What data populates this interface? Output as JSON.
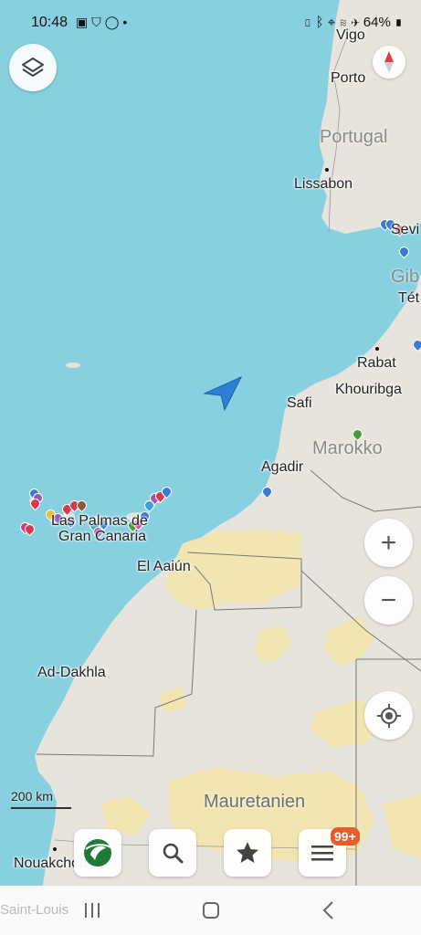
{
  "status_bar": {
    "time": "10:48",
    "left_icons": [
      "image-icon",
      "shield-icon",
      "whatsapp-icon",
      "dot-icon"
    ],
    "right_icons": [
      "sim-icon",
      "bluetooth-icon",
      "location-icon",
      "wifi-icon",
      "airplane-icon",
      "battery-icon"
    ],
    "battery": "64%"
  },
  "map": {
    "labels": {
      "vigo": "Vigo",
      "porto": "Porto",
      "portugal": "Portugal",
      "lissabon": "Lissabon",
      "sevilla": "Sevi",
      "gibraltar": "Gib",
      "tetouan": "Tét",
      "rabat": "Rabat",
      "khouribga": "Khouribga",
      "safi": "Safi",
      "marokko": "Marokko",
      "agadir": "Agadir",
      "las_palmas": "Las Palmas de",
      "gran_canaria": "Gran Canaria",
      "el_aaiun": "El Aaiún",
      "ad_dakhla": "Ad-Dakhla",
      "mauretanien": "Mauretanien",
      "nouakchott": "Nouakchott",
      "saint_louis": "Saint-Louis"
    },
    "scale_label": "200 km",
    "colors": {
      "water": "#87d0e0",
      "land": "#e6e4dc",
      "desert": "#f1e6b2",
      "position_arrow": "#2f7fd6"
    }
  },
  "controls": {
    "layers_icon": "layers-icon",
    "compass_icon": "compass-icon",
    "zoom_in": "+",
    "zoom_out": "−",
    "locate_icon": "locate-icon"
  },
  "toolbar": {
    "badge": "99+",
    "buttons": [
      "app-logo-icon",
      "search-icon",
      "star-icon",
      "menu-icon"
    ]
  }
}
